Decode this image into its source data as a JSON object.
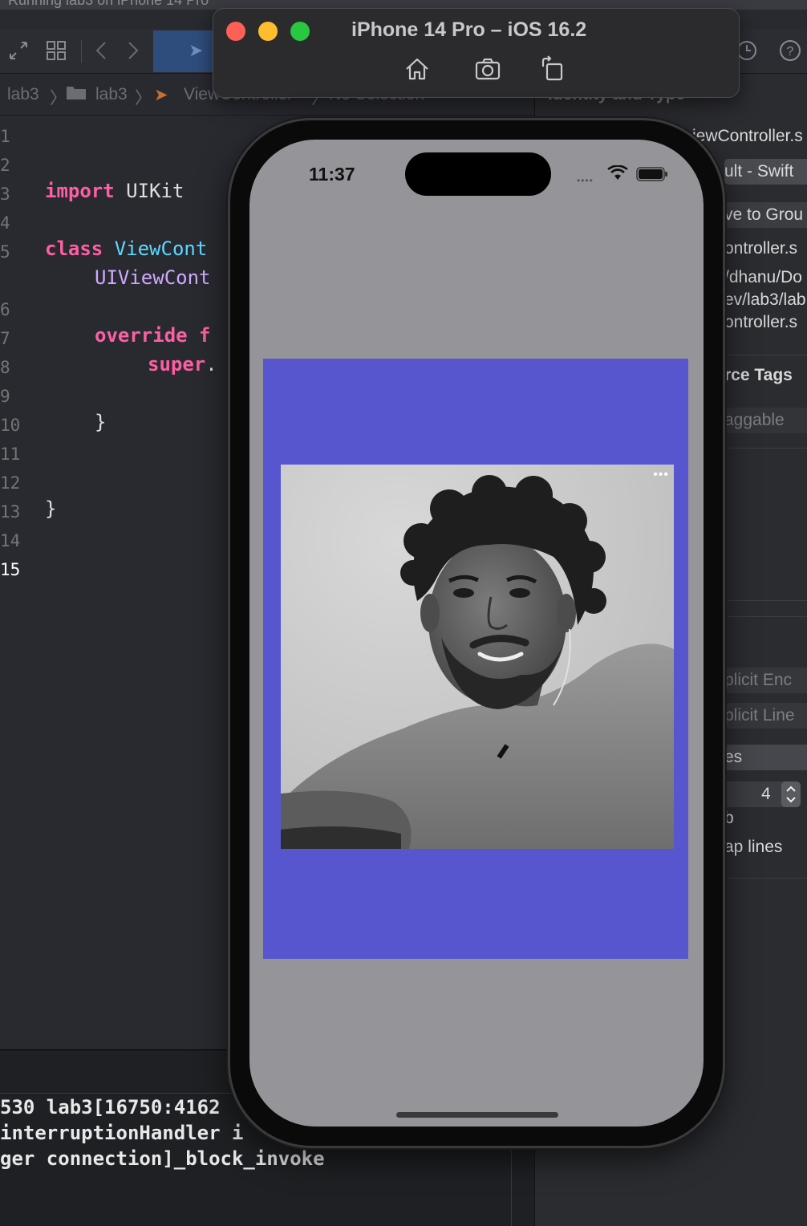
{
  "xcode": {
    "top_strip_text": "Running lab3 on iPhone 14 Pro",
    "breadcrumb": [
      "lab3",
      "lab3",
      "ViewController",
      "No Selection"
    ],
    "line_numbers": [
      "1",
      "2",
      "3",
      "4",
      "5",
      "",
      "6",
      "7",
      "8",
      "9",
      "10",
      "11",
      "12",
      "13",
      "14",
      "15"
    ],
    "code": {
      "l3_kw": "import",
      "l3_rest": " UIKit",
      "l5_kw": "class",
      "l5_ty": " ViewCont",
      "l5b": "UIViewCont",
      "l7_kw": "override",
      "l7_rest": " f",
      "l8_kw": "super",
      "l8_rest": ".",
      "l10": "}",
      "l13": "}"
    },
    "console": [
      "530 lab3[16750:4162",
      "interruptionHandler i",
      "ger connection]_block_invoke"
    ],
    "inspector": {
      "header": "Identity and Type",
      "name": "iewController.s",
      "type": "ult - Swift",
      "move_to_group": "ve to Grou",
      "full_path_lines": [
        "ontroller.s",
        "/dhanu/Do",
        "ev/lab3/lab",
        "ontroller.s"
      ],
      "resource_tags": "rce Tags",
      "draggable": "aggable",
      "explicit_enc": "plicit Enc",
      "explicit_line": "plicit Line",
      "spaces": "es",
      "indent_value": "4",
      "tab_label": "b",
      "wrap_lines": "ap lines"
    }
  },
  "simulator": {
    "title": "iPhone 14 Pro – iOS 16.2",
    "toolbar_buttons": [
      "home-icon",
      "screenshot-icon",
      "rotate-icon"
    ],
    "status_time": "11:37",
    "colors": {
      "view_background": "#959599",
      "container_view": "#5756ce",
      "close": "#fe5f57",
      "minimize": "#febc2e",
      "zoom": "#28c840"
    },
    "photo_menu": "•••"
  }
}
